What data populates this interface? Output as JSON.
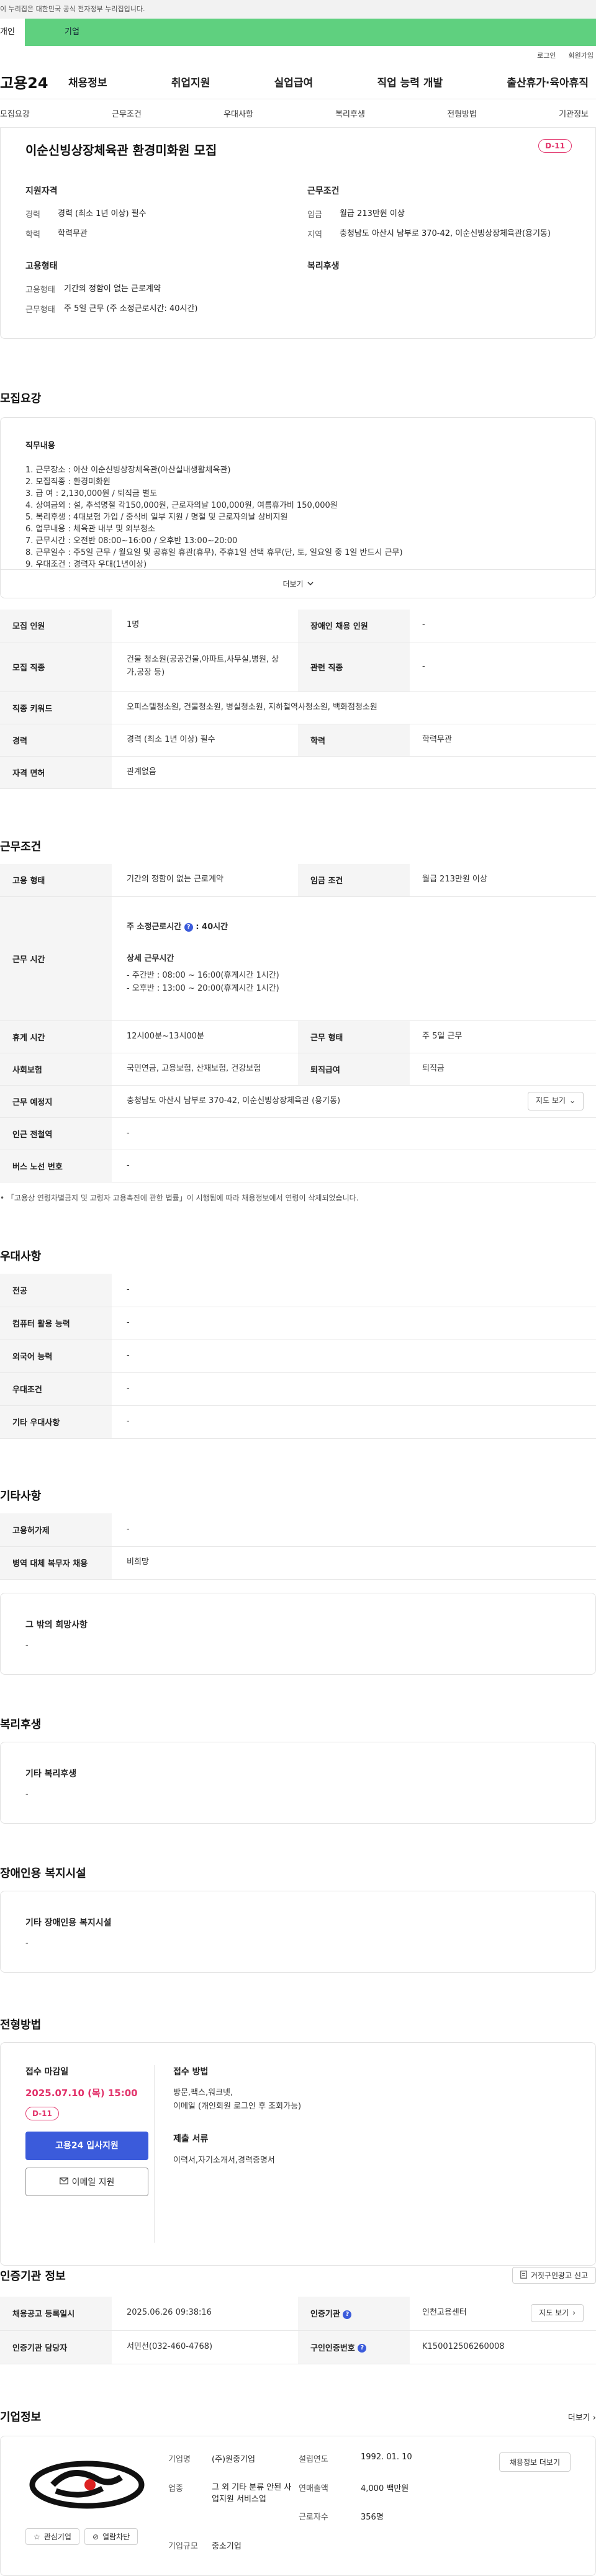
{
  "gov_bar": "이 누리집은 대한민국 공식 전자정부 누리집입니다.",
  "top_tabs": {
    "personal": "개인",
    "company": "기업"
  },
  "util_links": {
    "login": "로그인",
    "join": "회원가입"
  },
  "gnb": {
    "logo": "고용24",
    "menu": [
      "채용정보",
      "취업지원",
      "실업급여",
      "직업 능력 개발",
      "출산휴가·육아휴직"
    ]
  },
  "subtabs": [
    "모집요강",
    "근무조건",
    "우대사항",
    "복리후생",
    "전형방법",
    "기관정보"
  ],
  "summary": {
    "title": "이순신빙상장체육관 환경미화원 모집",
    "dday": "D-11",
    "qualification": {
      "heading": "지원자격",
      "career_k": "경력",
      "career_v": "경력 (최소 1년 이상) 필수",
      "edu_k": "학력",
      "edu_v": "학력무관"
    },
    "conditions": {
      "heading": "근무조건",
      "wage_k": "임금",
      "wage_v": "월급 213만원 이상",
      "location_k": "지역",
      "location_v": "충청남도 아산시 남부로 370-42, 이순신빙상장체육관(용기동)"
    },
    "employment": {
      "heading": "고용형태",
      "type_k": "고용형태",
      "type_v": "기간의 정함이 없는 근로계약",
      "hours_k": "근무형태",
      "hours_v": "주 5일 근무 (주 소정근로시간: 40시간)"
    },
    "welfare": {
      "heading": "복리후생"
    }
  },
  "recruit": {
    "section_title": "모집요강",
    "detail_heading": "직무내용",
    "detail_lines": [
      "1. 근무장소 : 아산 이순신빙상장체육관(아산실내생활체육관)",
      "2. 모집직종 : 환경미화원",
      "3. 급      여 : 2,130,000원 / 퇴직금 별도",
      "4. 상여금외 : 설, 추석명절 각150,000원, 근로자의날 100,000원, 여름휴가비 150,000원",
      "5. 복리후생 : 4대보험 가입 / 중식비 일부 지원 / 명절 및 근로자의날 상비지원",
      "6. 업무내용 : 체육관 내부 및 외부청소",
      "7. 근무시간 : 오전반 08:00~16:00 / 오후반 13:00~20:00",
      "8. 근무일수 : 주5일 근무 / 월요일 및 공휴일 휴관(휴무), 주휴1일 선택 휴무(단, 토, 일요일 중 1일 반드시 근무)",
      "9. 우대조건 : 경력자 우대(1년이상)"
    ],
    "more": "더보기",
    "rows": [
      {
        "k1": "모집 인원",
        "v1": "1명",
        "k2": "장애인 채용 인원",
        "v2": "-"
      },
      {
        "k1": "모집 직종",
        "v1": "건물 청소원(공공건물,아파트,사무실,병원, 상가,공장 등)",
        "k2": "관련 직종",
        "v2": "-"
      },
      {
        "k1": "직종 키워드",
        "v1": "오피스텔청소원, 건물청소원, 병실청소원, 지하철역사청소원, 백화점청소원"
      },
      {
        "k1": "경력",
        "v1": "경력 (최소 1년 이상) 필수",
        "k2": "학력",
        "v2": "학력무관"
      },
      {
        "k1": "자격 면허",
        "v1": "관계없음"
      }
    ]
  },
  "workcond": {
    "section_title": "근무조건",
    "employ_k": "고용 형태",
    "employ_v": "기간의 정함이 없는 근로계약",
    "wage_k": "임금 조건",
    "wage_v": "월급 213만원 이상",
    "hours_k": "근무 시간",
    "hours_total": "주 소정근로시간",
    "hours_total_v": ": 40시간",
    "hours_detail_h": "상세 근무시간",
    "hours_detail": [
      "- 주간반 : 08:00 ~ 16:00(휴게시간 1시간)",
      "- 오후반 : 13:00 ~ 20:00(휴게시간 1시간)"
    ],
    "rest_k": "휴게 시간",
    "rest_v": "12시00분~13시00분",
    "form_k": "근무 형태",
    "form_v": "주 5일 근무",
    "ins_k": "사회보험",
    "ins_v": "국민연금, 고용보험, 산재보험, 건강보험",
    "sev_k": "퇴직급여",
    "sev_v": "퇴직금",
    "place_k": "근무 예정지",
    "place_v": "충청남도 아산시 남부로 370-42, 이순신빙상장체육관 (용기동)",
    "map_btn": "지도 보기",
    "station_k": "인근 전철역",
    "station_v": "-",
    "bus_k": "버스 노선 번호",
    "bus_v": "-",
    "note": "「고용상 연령차별금지 및 고령자 고용촉진에 관한 법률」이 시행됨에 따라 채용정보에서 연령이 삭제되었습니다."
  },
  "pref": {
    "section_title": "우대사항",
    "rows": [
      {
        "k": "전공",
        "v": "-"
      },
      {
        "k": "컴퓨터 활용 능력",
        "v": "-"
      },
      {
        "k": "외국어 능력",
        "v": "-"
      },
      {
        "k": "우대조건",
        "v": "-"
      },
      {
        "k": "기타 우대사항",
        "v": "-"
      }
    ]
  },
  "etc": {
    "section_title": "기타사항",
    "rows": [
      {
        "k": "고용허가제",
        "v": "-"
      },
      {
        "k": "병역 대체 복무자 채용",
        "v": "비희망"
      }
    ],
    "other_h": "그 밖의 희망사항",
    "other_v": "-"
  },
  "welfare": {
    "section_title": "복리후생",
    "h": "기타 복리후생",
    "v": "-"
  },
  "disabled": {
    "section_title": "장애인용 복지시설",
    "h": "기타 장애인용 복지시설",
    "v": "-"
  },
  "apply": {
    "section_title": "전형방법",
    "deadline_h": "접수 마감일",
    "deadline": "2025.07.10 (목) 15:00",
    "dday": "D-11",
    "btn_online": "고용24 입사지원",
    "btn_email": "이메일 지원",
    "method_h": "접수 방법",
    "method_v1": "방문,팩스,워크넷,",
    "method_v2": "이메일 (개인회원 로그인 후 조회가능)",
    "docs_h": "제출 서류",
    "docs_v": "이력서,자기소개서,경력증명서"
  },
  "agency": {
    "section_title": "인증기관 정보",
    "report_btn": "거짓구인광고 신고",
    "reg_k": "채용공고 등록일시",
    "reg_v": "2025.06.26 09:38:16",
    "org_k": "인증기관",
    "org_v": "인천고용센터",
    "map_btn": "지도 보기",
    "mgr_k": "인증기관 담당자",
    "mgr_v": "서민선(032-460-4768)",
    "id_k": "구인인증번호",
    "id_v": "K150012506260008"
  },
  "company": {
    "section_title": "기업정보",
    "more": "더보기",
    "fav_btn": "관심기업",
    "block_btn": "열람차단",
    "name_k": "기업명",
    "name_v": "(주)원중기업",
    "year_k": "설립연도",
    "year_v": "1992. 01. 10",
    "jobs_btn": "채용정보 더보기",
    "ind_k": "업종",
    "ind_v": "그 외 기타 분류 안된 사업지원 서비스업",
    "sales_k": "연매출액",
    "sales_v": "4,000 백만원",
    "emp_k": "근로자수",
    "emp_v": "356명",
    "size_k": "기업규모",
    "size_v": "중소기업"
  },
  "colors": {
    "accent": "#3b5bdb",
    "dday": "#e2336b",
    "company_tab": "#5fd07f"
  }
}
